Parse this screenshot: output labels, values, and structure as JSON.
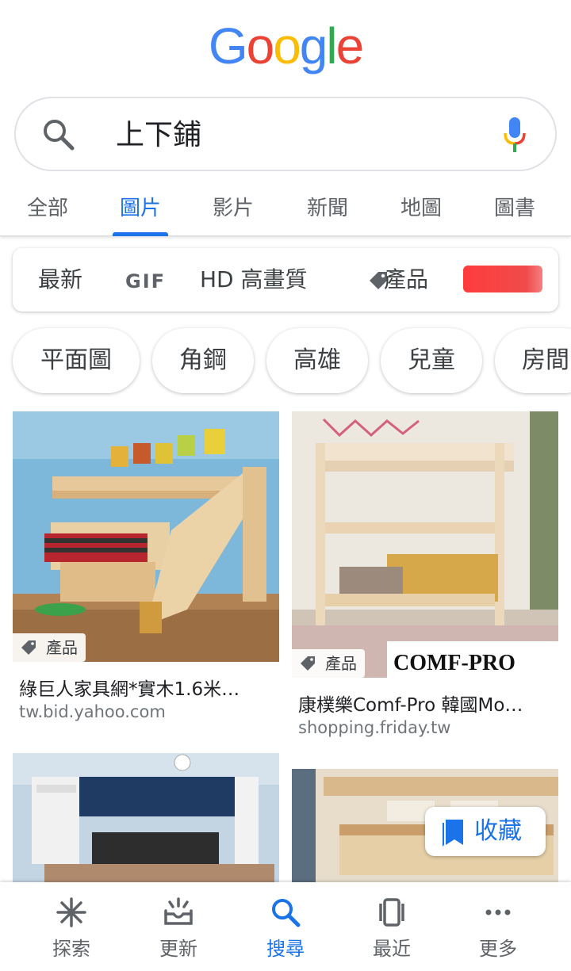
{
  "logo": {
    "letters": [
      "G",
      "o",
      "o",
      "g",
      "l",
      "e"
    ],
    "colors": [
      "#4285f4",
      "#ea4335",
      "#fbbc05",
      "#4285f4",
      "#34a853",
      "#ea4335"
    ]
  },
  "search": {
    "query": "上下鋪"
  },
  "tabs": [
    "全部",
    "圖片",
    "影片",
    "新聞",
    "地圖",
    "圖書"
  ],
  "active_tab": "圖片",
  "filters": {
    "latest": "最新",
    "gif": "GIF",
    "hd": "HD 高畫質",
    "products": "產品"
  },
  "chips": [
    "平面圖",
    "角鋼",
    "高雄",
    "兒童",
    "房間"
  ],
  "results": [
    {
      "badge": "產品",
      "title": "綠巨人家具網*實木1.6米…",
      "source": "tw.bid.yahoo.com"
    },
    {
      "badge": "產品",
      "title": "康樸樂Comf-Pro 韓國Mo…",
      "source": "shopping.friday.tw",
      "watermark": "COMF-PRO"
    }
  ],
  "save_button": "收藏",
  "bottom_nav": [
    "探索",
    "更新",
    "搜尋",
    "最近",
    "更多"
  ],
  "active_nav": "搜尋",
  "colors": {
    "accent": "#1a73e8",
    "text": "#3c4043",
    "secondary": "#70757a"
  }
}
